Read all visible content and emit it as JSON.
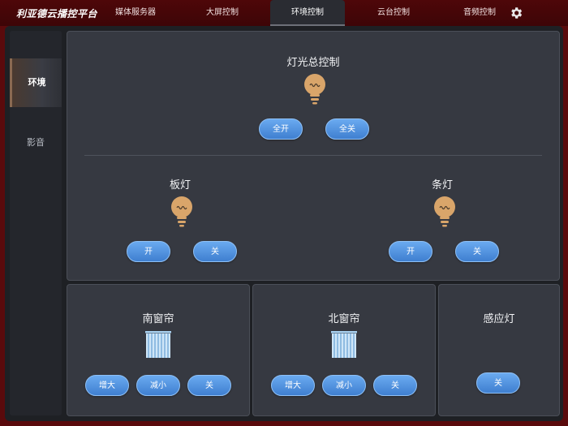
{
  "header": {
    "brand": "利亚德云播控平台",
    "tabs": [
      {
        "label": "媒体服务器",
        "active": false
      },
      {
        "label": "大屏控制",
        "active": false
      },
      {
        "label": "环境控制",
        "active": true
      },
      {
        "label": "云台控制",
        "active": false
      },
      {
        "label": "音频控制",
        "active": false
      }
    ],
    "settings_icon": "gear-icon"
  },
  "sidebar": {
    "items": [
      {
        "label": "环境",
        "active": true
      },
      {
        "label": "影音",
        "active": false
      }
    ]
  },
  "lighting": {
    "master": {
      "title": "灯光总控制",
      "all_on": "全开",
      "all_off": "全关"
    },
    "panel_light": {
      "title": "板灯",
      "on": "开",
      "off": "关"
    },
    "strip_light": {
      "title": "条灯",
      "on": "开",
      "off": "关"
    }
  },
  "curtains": {
    "south": {
      "title": "南窗帘",
      "increase": "增大",
      "decrease": "减小",
      "off": "关"
    },
    "north": {
      "title": "北窗帘",
      "increase": "增大",
      "decrease": "减小",
      "off": "关"
    }
  },
  "sensor_light": {
    "title": "感应灯",
    "off": "关"
  },
  "colors": {
    "accent_button": "#4f8fe0",
    "bulb": "#d9a56a",
    "panel_bg": "#363941",
    "header_bg": "#4e0709"
  }
}
